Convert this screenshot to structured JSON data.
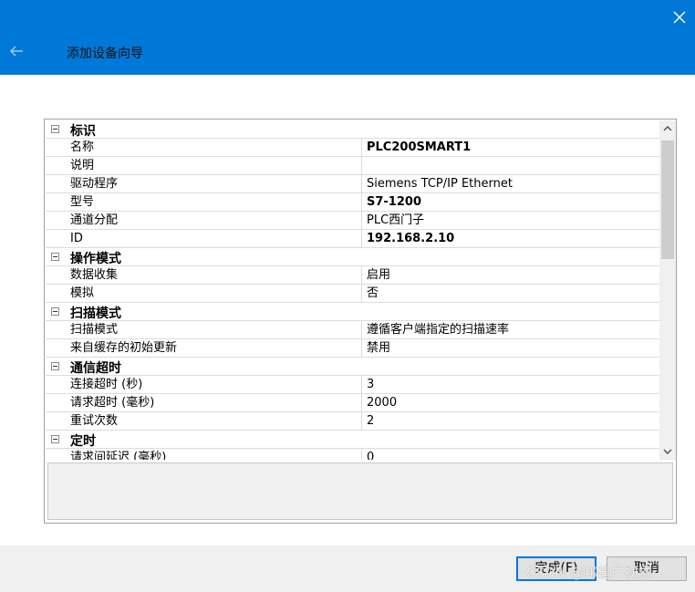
{
  "window": {
    "title": "添加设备向导"
  },
  "groups": [
    {
      "label": "标识",
      "rows": [
        {
          "name": "名称",
          "value": "PLC200SMART1",
          "bold": true
        },
        {
          "name": "说明",
          "value": "",
          "bold": false
        },
        {
          "name": "驱动程序",
          "value": "Siemens TCP/IP Ethernet",
          "bold": false
        },
        {
          "name": "型号",
          "value": "S7-1200",
          "bold": true
        },
        {
          "name": "通道分配",
          "value": "PLC西门子",
          "bold": false
        },
        {
          "name": "ID",
          "value": "192.168.2.10",
          "bold": true
        }
      ]
    },
    {
      "label": "操作模式",
      "rows": [
        {
          "name": "数据收集",
          "value": "启用",
          "bold": false
        },
        {
          "name": "模拟",
          "value": "否",
          "bold": false
        }
      ]
    },
    {
      "label": "扫描模式",
      "rows": [
        {
          "name": "扫描模式",
          "value": "遵循客户端指定的扫描速率",
          "bold": false
        },
        {
          "name": "来自缓存的初始更新",
          "value": "禁用",
          "bold": false
        }
      ]
    },
    {
      "label": "通信超时",
      "rows": [
        {
          "name": "连接超时 (秒)",
          "value": "3",
          "bold": false
        },
        {
          "name": "请求超时 (毫秒)",
          "value": "2000",
          "bold": false
        },
        {
          "name": "重试次数",
          "value": "2",
          "bold": false
        }
      ]
    },
    {
      "label": "定时",
      "rows": [
        {
          "name": "请求间延迟 (毫秒)",
          "value": "0",
          "bold": false
        }
      ]
    }
  ],
  "buttons": {
    "finish": "完成(F)",
    "cancel": "取消"
  },
  "watermark": "CSDN @邦建广视觉",
  "icons": {
    "close": "close-icon",
    "back": "arrow-left-icon",
    "collapse": "minus-box-icon"
  },
  "colors": {
    "titlebar": "#0078d7",
    "back_arrow": "#9fc9ee",
    "footer": "#f0f0f0"
  }
}
